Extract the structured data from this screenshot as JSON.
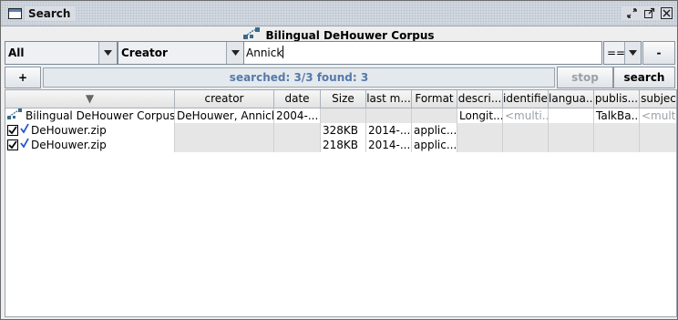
{
  "window": {
    "title": "Search"
  },
  "corpus_header": {
    "label": "Bilingual DeHouwer Corpus"
  },
  "search": {
    "scope_value": "All",
    "field_value": "Creator",
    "query_value": "Annick",
    "operator_value": "==",
    "remove_label": "-"
  },
  "results": {
    "add_label": "+",
    "status_text": "searched: 3/3 found: 3",
    "stop_label": "stop",
    "search_label": "search"
  },
  "table": {
    "columns": [
      "▼",
      "creator",
      "date",
      "Size",
      "last m...",
      "Format",
      "descri...",
      "identifier",
      "langua...",
      "publis...",
      "subjec"
    ],
    "rows": [
      {
        "name": "Bilingual DeHouwer Corpus",
        "icon": "corpus-icon",
        "cells": [
          "DeHouwer, Annick",
          "2004-...",
          "",
          "",
          "",
          "Longit...",
          "<multi...",
          "",
          "TalkBa...",
          "<multi..."
        ]
      },
      {
        "name": "DeHouwer.zip",
        "icon": "checked-file-icon",
        "cells": [
          "",
          "",
          "328KB",
          "2014-...",
          "applic...",
          "",
          "",
          "",
          "",
          ""
        ]
      },
      {
        "name": "DeHouwer.zip",
        "icon": "checked-file-icon",
        "cells": [
          "",
          "",
          "218KB",
          "2014-...",
          "applic...",
          "",
          "",
          "",
          "",
          ""
        ]
      }
    ]
  },
  "colors": {
    "status_text": "#5679a8",
    "checkmark": "#2255cc",
    "corpus_icon": "#3a6a8a"
  }
}
